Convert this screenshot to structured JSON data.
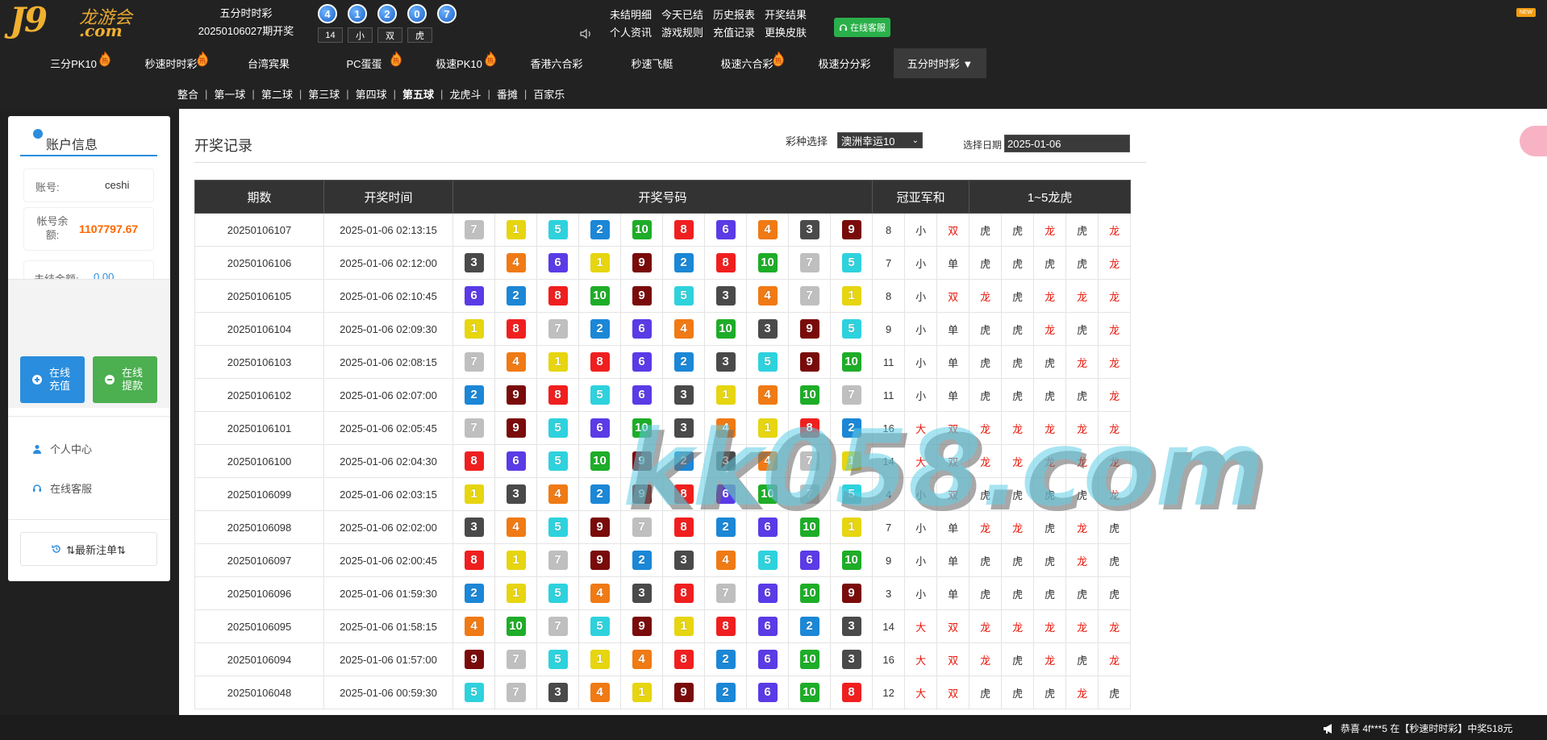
{
  "logo": {
    "main": "J9",
    "cn": "龙游会",
    "com": ".com"
  },
  "header": {
    "lottery_name": "五分时时彩",
    "period_text": "20250106027期开奖",
    "balls": [
      "4",
      "1",
      "2",
      "0",
      "7"
    ],
    "stats": [
      "14",
      "小",
      "双",
      "虎"
    ],
    "links_row1": [
      "未结明细",
      "今天已结",
      "历史报表",
      "开奖结果"
    ],
    "links_row2": [
      "个人资讯",
      "游戏规则",
      "充值记录",
      "更换皮肤"
    ],
    "service_label": "在线客服",
    "new_badge": "NEW"
  },
  "nav": {
    "items": [
      {
        "label": "三分PK10",
        "hot": true
      },
      {
        "label": "秒速时时彩",
        "hot": true
      },
      {
        "label": "台湾宾果",
        "hot": false
      },
      {
        "label": "PC蛋蛋",
        "hot": true
      },
      {
        "label": "极速PK10",
        "hot": true
      },
      {
        "label": "香港六合彩",
        "hot": false
      },
      {
        "label": "秒速飞艇",
        "hot": false
      },
      {
        "label": "极速六合彩",
        "hot": true
      },
      {
        "label": "极速分分彩",
        "hot": false
      },
      {
        "label": "五分时时彩 ▼",
        "hot": false
      }
    ],
    "hot_text": "热"
  },
  "subnav": [
    "整合",
    "第一球",
    "第二球",
    "第三球",
    "第四球",
    "第五球",
    "龙虎斗",
    "番摊",
    "百家乐"
  ],
  "sidebar": {
    "title": "账户信息",
    "account_label": "账号:",
    "account_value": "ceshi",
    "balance_label": "帐号余额:",
    "balance_value": "1107797.67",
    "unsettled_label": "未结金额:",
    "unsettled_value": "0.00",
    "deposit_label": "在线充值",
    "withdraw_label": "在线提款",
    "personal_center": "个人中心",
    "online_service": "在线客服",
    "latest_bets": "⇅最新注单⇅"
  },
  "main": {
    "title": "开奖记录",
    "select_label": "彩种选择",
    "select_value": "澳洲幸运10",
    "date_label": "选择日期",
    "date_value": "2025-01-06",
    "watermark": "kk058.com"
  },
  "table": {
    "headers": {
      "period": "期数",
      "time": "开奖时间",
      "numbers": "开奖号码",
      "sum": "冠亚军和",
      "dragon_tiger": "1~5龙虎"
    }
  },
  "ball_colors": {
    "1": "#e6d50f",
    "2": "#1b87d6",
    "3": "#4a4a4a",
    "4": "#f07a14",
    "5": "#2ed2dd",
    "6": "#5a3be6",
    "7": "#bfbfbf",
    "8": "#f01f1f",
    "9": "#7a0b0b",
    "10": "#1ead28"
  },
  "rows": [
    {
      "period": "20250106107",
      "time": "2025-01-06 02:13:15",
      "nums": [
        7,
        1,
        5,
        2,
        10,
        8,
        6,
        4,
        3,
        9
      ],
      "sum": "8",
      "size": "小",
      "parity": "双",
      "dt": [
        "虎",
        "虎",
        "龙",
        "虎",
        "龙"
      ]
    },
    {
      "period": "20250106106",
      "time": "2025-01-06 02:12:00",
      "nums": [
        3,
        4,
        6,
        1,
        9,
        2,
        8,
        10,
        7,
        5
      ],
      "sum": "7",
      "size": "小",
      "parity": "单",
      "dt": [
        "虎",
        "虎",
        "虎",
        "虎",
        "龙"
      ]
    },
    {
      "period": "20250106105",
      "time": "2025-01-06 02:10:45",
      "nums": [
        6,
        2,
        8,
        10,
        9,
        5,
        3,
        4,
        7,
        1
      ],
      "sum": "8",
      "size": "小",
      "parity": "双",
      "dt": [
        "龙",
        "虎",
        "龙",
        "龙",
        "龙"
      ]
    },
    {
      "period": "20250106104",
      "time": "2025-01-06 02:09:30",
      "nums": [
        1,
        8,
        7,
        2,
        6,
        4,
        10,
        3,
        9,
        5
      ],
      "sum": "9",
      "size": "小",
      "parity": "单",
      "dt": [
        "虎",
        "虎",
        "龙",
        "虎",
        "龙"
      ]
    },
    {
      "period": "20250106103",
      "time": "2025-01-06 02:08:15",
      "nums": [
        7,
        4,
        1,
        8,
        6,
        2,
        3,
        5,
        9,
        10
      ],
      "sum": "11",
      "size": "小",
      "parity": "单",
      "dt": [
        "虎",
        "虎",
        "虎",
        "龙",
        "龙"
      ]
    },
    {
      "period": "20250106102",
      "time": "2025-01-06 02:07:00",
      "nums": [
        2,
        9,
        8,
        5,
        6,
        3,
        1,
        4,
        10,
        7
      ],
      "sum": "11",
      "size": "小",
      "parity": "单",
      "dt": [
        "虎",
        "虎",
        "虎",
        "虎",
        "龙"
      ]
    },
    {
      "period": "20250106101",
      "time": "2025-01-06 02:05:45",
      "nums": [
        7,
        9,
        5,
        6,
        10,
        3,
        4,
        1,
        8,
        2
      ],
      "sum": "16",
      "size": "大",
      "parity": "双",
      "dt": [
        "龙",
        "龙",
        "龙",
        "龙",
        "龙"
      ]
    },
    {
      "period": "20250106100",
      "time": "2025-01-06 02:04:30",
      "nums": [
        8,
        6,
        5,
        10,
        9,
        2,
        3,
        4,
        7,
        1
      ],
      "sum": "14",
      "size": "大",
      "parity": "双",
      "dt": [
        "龙",
        "龙",
        "龙",
        "龙",
        "龙"
      ]
    },
    {
      "period": "20250106099",
      "time": "2025-01-06 02:03:15",
      "nums": [
        1,
        3,
        4,
        2,
        9,
        8,
        6,
        10,
        7,
        5
      ],
      "sum": "4",
      "size": "小",
      "parity": "双",
      "dt": [
        "虎",
        "虎",
        "虎",
        "虎",
        "龙"
      ]
    },
    {
      "period": "20250106098",
      "time": "2025-01-06 02:02:00",
      "nums": [
        3,
        4,
        5,
        9,
        7,
        8,
        2,
        6,
        10,
        1
      ],
      "sum": "7",
      "size": "小",
      "parity": "单",
      "dt": [
        "龙",
        "龙",
        "虎",
        "龙",
        "虎"
      ]
    },
    {
      "period": "20250106097",
      "time": "2025-01-06 02:00:45",
      "nums": [
        8,
        1,
        7,
        9,
        2,
        3,
        4,
        5,
        6,
        10
      ],
      "sum": "9",
      "size": "小",
      "parity": "单",
      "dt": [
        "虎",
        "虎",
        "虎",
        "龙",
        "虎"
      ]
    },
    {
      "period": "20250106096",
      "time": "2025-01-06 01:59:30",
      "nums": [
        2,
        1,
        5,
        4,
        3,
        8,
        7,
        6,
        10,
        9
      ],
      "sum": "3",
      "size": "小",
      "parity": "单",
      "dt": [
        "虎",
        "虎",
        "虎",
        "虎",
        "虎"
      ]
    },
    {
      "period": "20250106095",
      "time": "2025-01-06 01:58:15",
      "nums": [
        4,
        10,
        7,
        5,
        9,
        1,
        8,
        6,
        2,
        3
      ],
      "sum": "14",
      "size": "大",
      "parity": "双",
      "dt": [
        "龙",
        "龙",
        "龙",
        "龙",
        "龙"
      ]
    },
    {
      "period": "20250106094",
      "time": "2025-01-06 01:57:00",
      "nums": [
        9,
        7,
        5,
        1,
        4,
        8,
        2,
        6,
        10,
        3
      ],
      "sum": "16",
      "size": "大",
      "parity": "双",
      "dt": [
        "龙",
        "虎",
        "龙",
        "虎",
        "龙"
      ]
    },
    {
      "period": "20250106048",
      "time": "2025-01-06 00:59:30",
      "nums": [
        5,
        7,
        3,
        4,
        1,
        9,
        2,
        6,
        10,
        8
      ],
      "sum": "12",
      "size": "大",
      "parity": "双",
      "dt": [
        "虎",
        "虎",
        "虎",
        "龙",
        "虎"
      ]
    }
  ],
  "footer": {
    "ticker": "恭喜 4f***5 在【秒速时时彩】中奖518元"
  }
}
